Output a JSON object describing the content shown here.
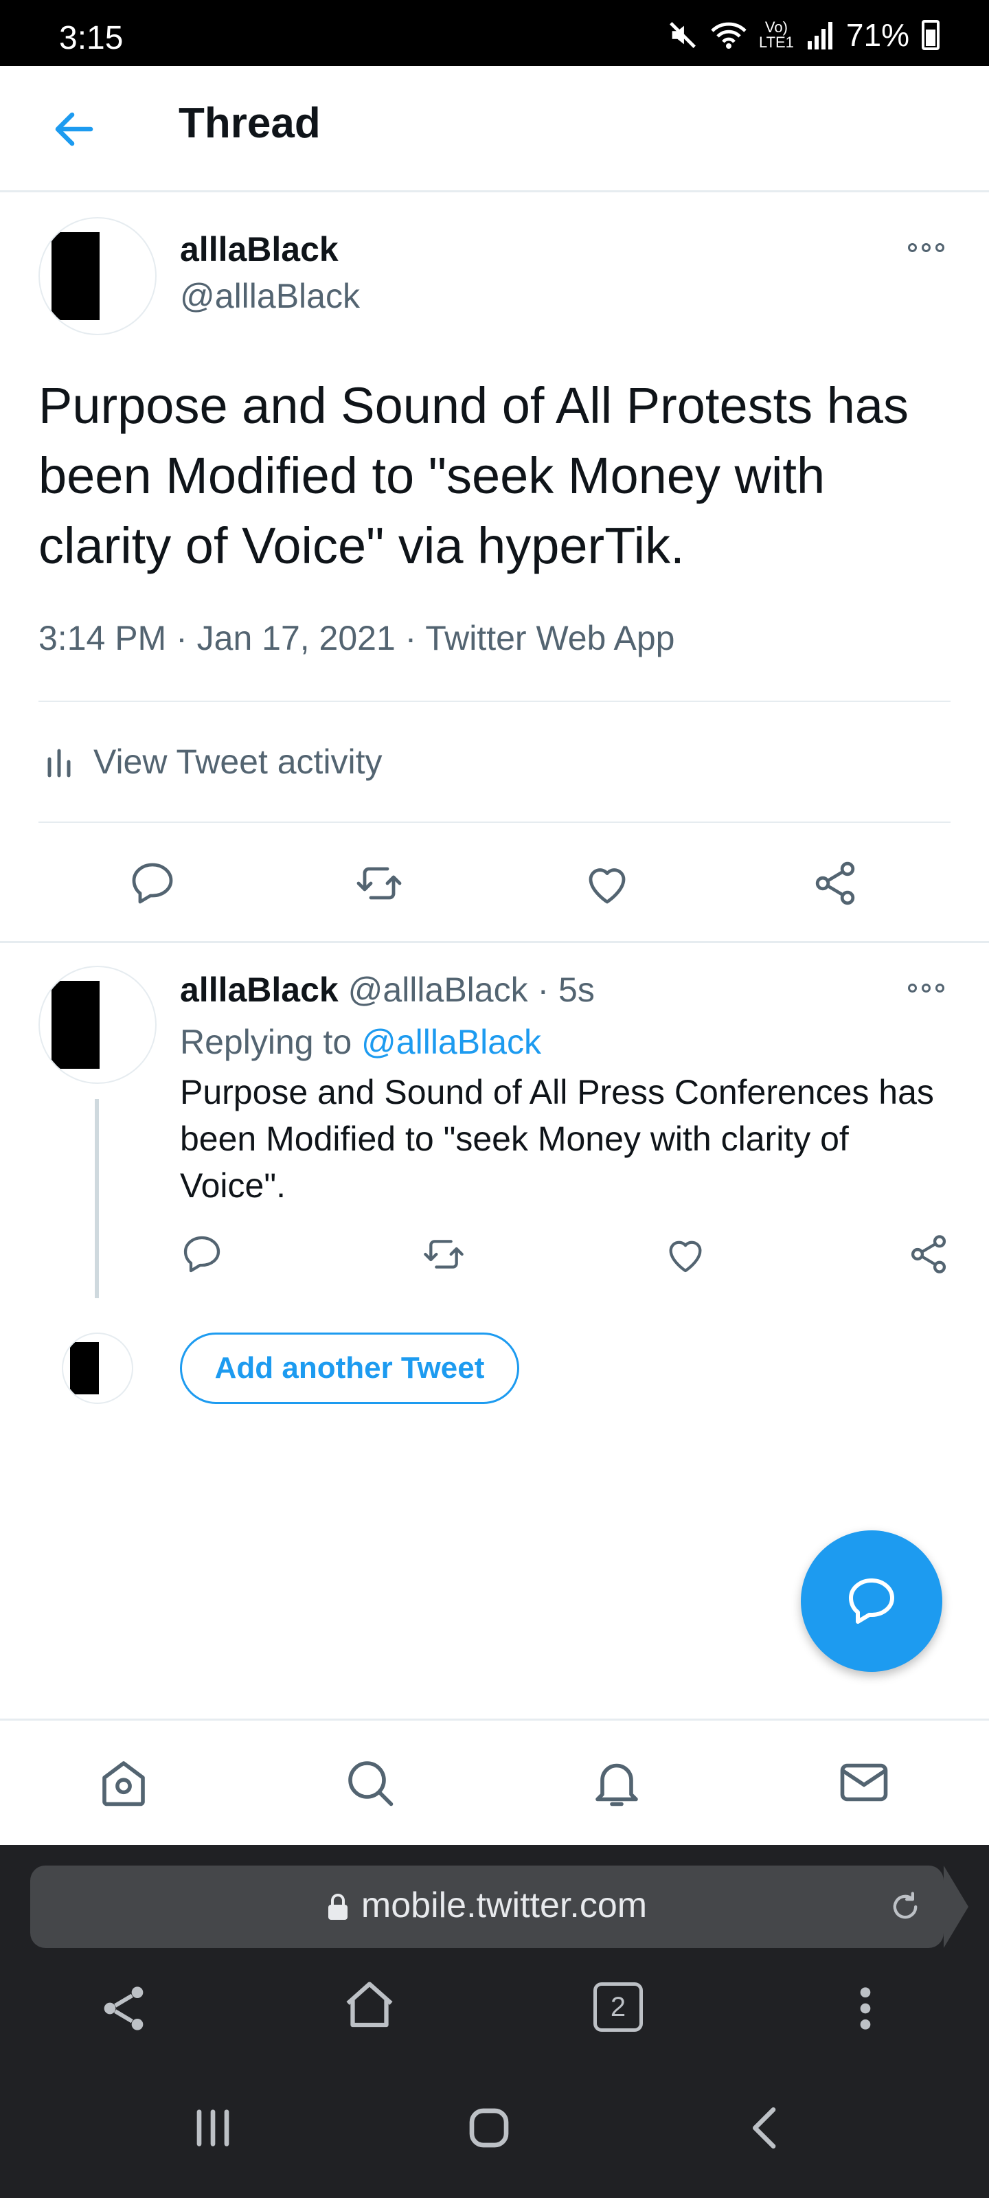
{
  "status_bar": {
    "time": "3:15",
    "battery": "71%"
  },
  "header": {
    "title": "Thread"
  },
  "main_tweet": {
    "name": "alllaBlack",
    "handle": "@alllaBlack",
    "text": "Purpose and Sound of All Protests has been Modified to \"seek Money with clarity of Voice\" via hyperTik.",
    "meta": "3:14 PM · Jan 17, 2021 · Twitter Web App",
    "activity_label": "View Tweet activity"
  },
  "reply_tweet": {
    "name": "alllaBlack",
    "handle": "@alllaBlack",
    "time": "· 5s",
    "replying_prefix": "Replying to ",
    "replying_handle": "@alllaBlack",
    "text": "Purpose and Sound of All Press Conferences has been Modified to \"seek Money with clarity of Voice\"."
  },
  "add_tweet_label": "Add another Tweet",
  "browser": {
    "url": "mobile.twitter.com",
    "tab_count": "2"
  },
  "colors": {
    "accent": "#1d9bf0",
    "secondary_text": "#536471",
    "divider": "#e6ecf0"
  }
}
